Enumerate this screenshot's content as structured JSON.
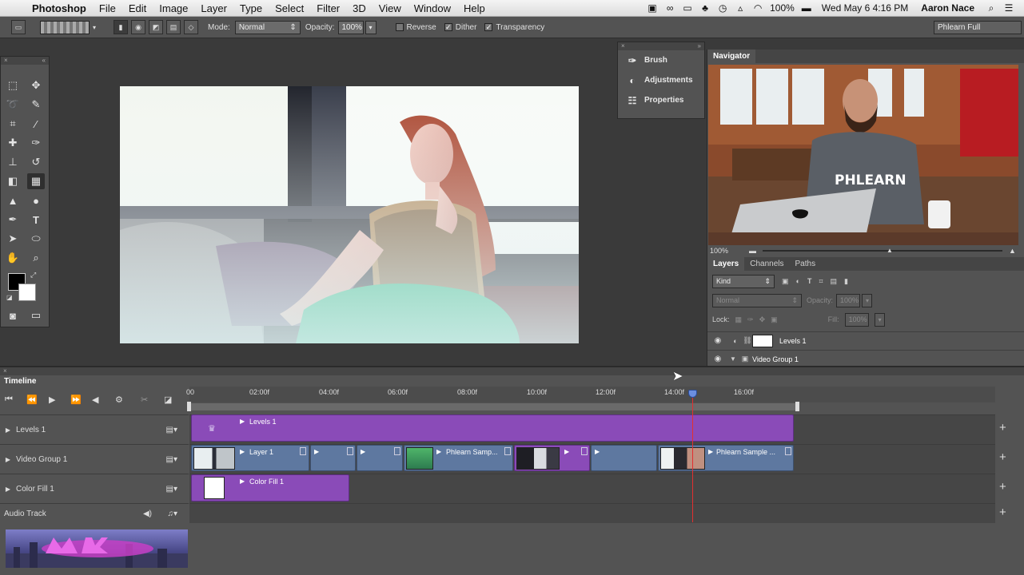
{
  "menubar": {
    "app": "Photoshop",
    "items": [
      "File",
      "Edit",
      "Image",
      "Layer",
      "Type",
      "Select",
      "Filter",
      "3D",
      "View",
      "Window",
      "Help"
    ],
    "battery": "100%",
    "datetime": "Wed May 6  4:16 PM",
    "user": "Aaron Nace"
  },
  "options": {
    "mode_label": "Mode:",
    "mode_value": "Normal",
    "opacity_label": "Opacity:",
    "opacity_value": "100%",
    "reverse": "Reverse",
    "dither": "Dither",
    "transparency": "Transparency",
    "workspace": "Phlearn Full"
  },
  "minipanel": {
    "items": [
      "Brush",
      "Adjustments",
      "Properties"
    ]
  },
  "navigator": {
    "tab": "Navigator",
    "zoom": "100%",
    "shirt_text": "PHLEARN"
  },
  "layers": {
    "tabs": [
      "Layers",
      "Channels",
      "Paths"
    ],
    "kind": "Kind",
    "blend": "Normal",
    "opacity_label": "Opacity:",
    "opacity_value": "100%",
    "lock_label": "Lock:",
    "fill_label": "Fill:",
    "fill_value": "100%",
    "rows": [
      "Levels 1",
      "Video Group 1"
    ]
  },
  "timeline": {
    "title": "Timeline",
    "ruler": [
      "00",
      "02:00f",
      "04:00f",
      "06:00f",
      "08:00f",
      "10:00f",
      "12:00f",
      "14:00f",
      "16:00f"
    ],
    "tracks": [
      "Levels 1",
      "Video Group 1",
      "Color Fill 1",
      "Audio Track"
    ],
    "clips": {
      "levels": "Levels 1",
      "layer1": "Layer 1",
      "sample1": "Phlearn Samp...",
      "sample2": "Phlearn Sample ...",
      "colorfill": "Color Fill 1"
    }
  }
}
